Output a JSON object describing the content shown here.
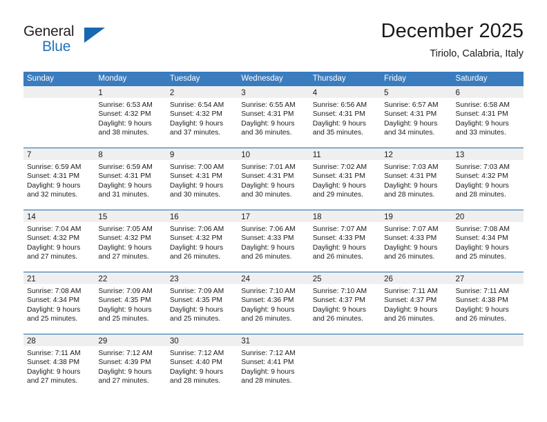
{
  "brand": {
    "word1": "General",
    "word2": "Blue",
    "logo_icon": "triangle-logo-icon",
    "accent_color": "#1668b0"
  },
  "header": {
    "title": "December 2025",
    "subtitle": "Tiriolo, Calabria, Italy"
  },
  "theme": {
    "header_row_bg": "#3a7cbe",
    "row_divider": "#1668b0",
    "date_band_bg": "#efefef",
    "text": "#1a1a1a"
  },
  "weekday_headers": [
    "Sunday",
    "Monday",
    "Tuesday",
    "Wednesday",
    "Thursday",
    "Friday",
    "Saturday"
  ],
  "weeks": [
    [
      {
        "day": "",
        "lines": []
      },
      {
        "day": "1",
        "lines": [
          "Sunrise: 6:53 AM",
          "Sunset: 4:32 PM",
          "Daylight: 9 hours",
          "and 38 minutes."
        ]
      },
      {
        "day": "2",
        "lines": [
          "Sunrise: 6:54 AM",
          "Sunset: 4:32 PM",
          "Daylight: 9 hours",
          "and 37 minutes."
        ]
      },
      {
        "day": "3",
        "lines": [
          "Sunrise: 6:55 AM",
          "Sunset: 4:31 PM",
          "Daylight: 9 hours",
          "and 36 minutes."
        ]
      },
      {
        "day": "4",
        "lines": [
          "Sunrise: 6:56 AM",
          "Sunset: 4:31 PM",
          "Daylight: 9 hours",
          "and 35 minutes."
        ]
      },
      {
        "day": "5",
        "lines": [
          "Sunrise: 6:57 AM",
          "Sunset: 4:31 PM",
          "Daylight: 9 hours",
          "and 34 minutes."
        ]
      },
      {
        "day": "6",
        "lines": [
          "Sunrise: 6:58 AM",
          "Sunset: 4:31 PM",
          "Daylight: 9 hours",
          "and 33 minutes."
        ]
      }
    ],
    [
      {
        "day": "7",
        "lines": [
          "Sunrise: 6:59 AM",
          "Sunset: 4:31 PM",
          "Daylight: 9 hours",
          "and 32 minutes."
        ]
      },
      {
        "day": "8",
        "lines": [
          "Sunrise: 6:59 AM",
          "Sunset: 4:31 PM",
          "Daylight: 9 hours",
          "and 31 minutes."
        ]
      },
      {
        "day": "9",
        "lines": [
          "Sunrise: 7:00 AM",
          "Sunset: 4:31 PM",
          "Daylight: 9 hours",
          "and 30 minutes."
        ]
      },
      {
        "day": "10",
        "lines": [
          "Sunrise: 7:01 AM",
          "Sunset: 4:31 PM",
          "Daylight: 9 hours",
          "and 30 minutes."
        ]
      },
      {
        "day": "11",
        "lines": [
          "Sunrise: 7:02 AM",
          "Sunset: 4:31 PM",
          "Daylight: 9 hours",
          "and 29 minutes."
        ]
      },
      {
        "day": "12",
        "lines": [
          "Sunrise: 7:03 AM",
          "Sunset: 4:31 PM",
          "Daylight: 9 hours",
          "and 28 minutes."
        ]
      },
      {
        "day": "13",
        "lines": [
          "Sunrise: 7:03 AM",
          "Sunset: 4:32 PM",
          "Daylight: 9 hours",
          "and 28 minutes."
        ]
      }
    ],
    [
      {
        "day": "14",
        "lines": [
          "Sunrise: 7:04 AM",
          "Sunset: 4:32 PM",
          "Daylight: 9 hours",
          "and 27 minutes."
        ]
      },
      {
        "day": "15",
        "lines": [
          "Sunrise: 7:05 AM",
          "Sunset: 4:32 PM",
          "Daylight: 9 hours",
          "and 27 minutes."
        ]
      },
      {
        "day": "16",
        "lines": [
          "Sunrise: 7:06 AM",
          "Sunset: 4:32 PM",
          "Daylight: 9 hours",
          "and 26 minutes."
        ]
      },
      {
        "day": "17",
        "lines": [
          "Sunrise: 7:06 AM",
          "Sunset: 4:33 PM",
          "Daylight: 9 hours",
          "and 26 minutes."
        ]
      },
      {
        "day": "18",
        "lines": [
          "Sunrise: 7:07 AM",
          "Sunset: 4:33 PM",
          "Daylight: 9 hours",
          "and 26 minutes."
        ]
      },
      {
        "day": "19",
        "lines": [
          "Sunrise: 7:07 AM",
          "Sunset: 4:33 PM",
          "Daylight: 9 hours",
          "and 26 minutes."
        ]
      },
      {
        "day": "20",
        "lines": [
          "Sunrise: 7:08 AM",
          "Sunset: 4:34 PM",
          "Daylight: 9 hours",
          "and 25 minutes."
        ]
      }
    ],
    [
      {
        "day": "21",
        "lines": [
          "Sunrise: 7:08 AM",
          "Sunset: 4:34 PM",
          "Daylight: 9 hours",
          "and 25 minutes."
        ]
      },
      {
        "day": "22",
        "lines": [
          "Sunrise: 7:09 AM",
          "Sunset: 4:35 PM",
          "Daylight: 9 hours",
          "and 25 minutes."
        ]
      },
      {
        "day": "23",
        "lines": [
          "Sunrise: 7:09 AM",
          "Sunset: 4:35 PM",
          "Daylight: 9 hours",
          "and 25 minutes."
        ]
      },
      {
        "day": "24",
        "lines": [
          "Sunrise: 7:10 AM",
          "Sunset: 4:36 PM",
          "Daylight: 9 hours",
          "and 26 minutes."
        ]
      },
      {
        "day": "25",
        "lines": [
          "Sunrise: 7:10 AM",
          "Sunset: 4:37 PM",
          "Daylight: 9 hours",
          "and 26 minutes."
        ]
      },
      {
        "day": "26",
        "lines": [
          "Sunrise: 7:11 AM",
          "Sunset: 4:37 PM",
          "Daylight: 9 hours",
          "and 26 minutes."
        ]
      },
      {
        "day": "27",
        "lines": [
          "Sunrise: 7:11 AM",
          "Sunset: 4:38 PM",
          "Daylight: 9 hours",
          "and 26 minutes."
        ]
      }
    ],
    [
      {
        "day": "28",
        "lines": [
          "Sunrise: 7:11 AM",
          "Sunset: 4:38 PM",
          "Daylight: 9 hours",
          "and 27 minutes."
        ]
      },
      {
        "day": "29",
        "lines": [
          "Sunrise: 7:12 AM",
          "Sunset: 4:39 PM",
          "Daylight: 9 hours",
          "and 27 minutes."
        ]
      },
      {
        "day": "30",
        "lines": [
          "Sunrise: 7:12 AM",
          "Sunset: 4:40 PM",
          "Daylight: 9 hours",
          "and 28 minutes."
        ]
      },
      {
        "day": "31",
        "lines": [
          "Sunrise: 7:12 AM",
          "Sunset: 4:41 PM",
          "Daylight: 9 hours",
          "and 28 minutes."
        ]
      },
      {
        "day": "",
        "lines": []
      },
      {
        "day": "",
        "lines": []
      },
      {
        "day": "",
        "lines": []
      }
    ]
  ]
}
